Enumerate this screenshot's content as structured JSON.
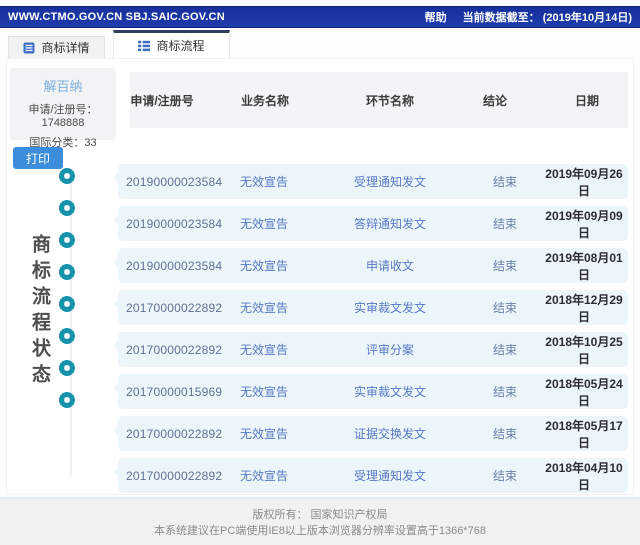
{
  "topbar": {
    "site": "WWW.CTMO.GOV.CN SBJ.SAIC.GOV.CN",
    "help": "帮助",
    "data_cutoff": "当前数据截至： (2019年10月14日)"
  },
  "tabs": {
    "details": "商标详情",
    "process": "商标流程"
  },
  "icons": {
    "details_tab": "doc-list-icon",
    "process_tab": "list-icon"
  },
  "trademark": {
    "name": "解百纳",
    "reg_line": "申请/注册号：1748888",
    "class_line": "国际分类：33"
  },
  "print_label": "打印",
  "side_title": "商标流程状态",
  "table": {
    "headers": [
      "申请/注册号",
      "业务名称",
      "环节名称",
      "结论",
      "日期"
    ],
    "rows": [
      {
        "regno": "20190000023584",
        "biz": "无效宣告",
        "stage": "受理通知发文",
        "result": "结束",
        "date": "2019年09月26日"
      },
      {
        "regno": "20190000023584",
        "biz": "无效宣告",
        "stage": "答辩通知发文",
        "result": "结束",
        "date": "2019年09月09日"
      },
      {
        "regno": "20190000023584",
        "biz": "无效宣告",
        "stage": "申请收文",
        "result": "结束",
        "date": "2019年08月01日"
      },
      {
        "regno": "20170000022892",
        "biz": "无效宣告",
        "stage": "实审裁文发文",
        "result": "结束",
        "date": "2018年12月29日"
      },
      {
        "regno": "20170000022892",
        "biz": "无效宣告",
        "stage": "评审分案",
        "result": "结束",
        "date": "2018年10月25日"
      },
      {
        "regno": "20170000015969",
        "biz": "无效宣告",
        "stage": "实审裁文发文",
        "result": "结束",
        "date": "2018年05月24日"
      },
      {
        "regno": "20170000022892",
        "biz": "无效宣告",
        "stage": "证据交换发文",
        "result": "结束",
        "date": "2018年05月17日"
      },
      {
        "regno": "20170000022892",
        "biz": "无效宣告",
        "stage": "受理通知发文",
        "result": "结束",
        "date": "2018年04月10日"
      }
    ]
  },
  "footer": {
    "line1": "版权所有： 国家知识产权局",
    "line2": "本系统建议在PC端使用IE8以上版本浏览器分辨率设置高于1366*768"
  },
  "colors": {
    "topbar_bg": "#1b37a6",
    "accent_blue": "#3c8edb",
    "timeline_teal": "#1793ad",
    "row_bg": "#ecf5fa",
    "link_blue": "#5679c5"
  }
}
